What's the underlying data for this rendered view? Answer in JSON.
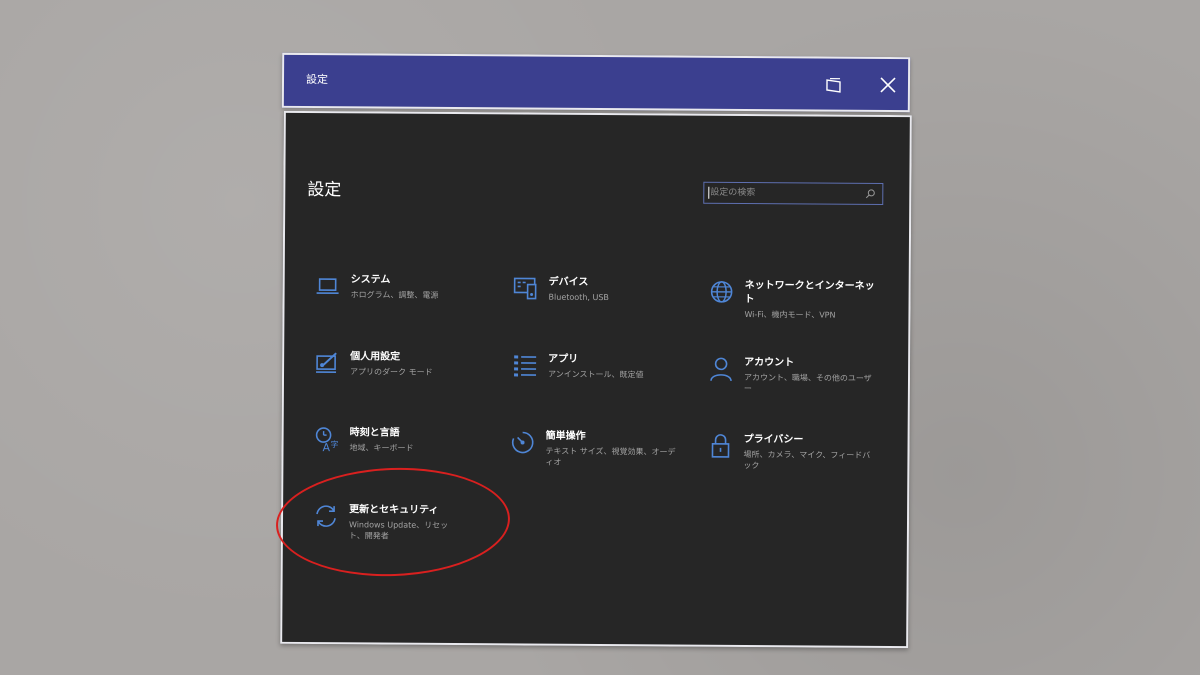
{
  "window": {
    "title": "設定"
  },
  "page": {
    "heading": "設定",
    "search": {
      "placeholder": "設定の検索"
    }
  },
  "tiles": [
    {
      "title": "システム",
      "subtitle": "ホログラム、調整、電源",
      "icon": "laptop-icon"
    },
    {
      "title": "デバイス",
      "subtitle": "Bluetooth, USB",
      "icon": "keyboard-devices-icon"
    },
    {
      "title": "ネットワークとインターネット",
      "subtitle": "Wi-Fi、機内モード、VPN",
      "icon": "globe-icon"
    },
    {
      "title": "個人用設定",
      "subtitle": "アプリのダーク モード",
      "icon": "paint-brush-icon"
    },
    {
      "title": "アプリ",
      "subtitle": "アンインストール、既定値",
      "icon": "apps-list-icon"
    },
    {
      "title": "アカウント",
      "subtitle": "アカウント、職場、その他のユーザー",
      "icon": "person-icon"
    },
    {
      "title": "時刻と言語",
      "subtitle": "地域、キーボード",
      "icon": "time-language-icon"
    },
    {
      "title": "簡単操作",
      "subtitle": "テキスト サイズ、視覚効果、オーディオ",
      "icon": "ease-of-access-icon"
    },
    {
      "title": "プライバシー",
      "subtitle": "場所、カメラ、マイク、フィードバック",
      "icon": "lock-icon"
    },
    {
      "title": "更新とセキュリティ",
      "subtitle": "Windows Update、リセット、開発者",
      "icon": "sync-icon"
    }
  ],
  "colors": {
    "titlebar": "#3b3f8f",
    "panel": "#262626",
    "accent": "#4f86d6",
    "annotation": "#d9201f"
  }
}
